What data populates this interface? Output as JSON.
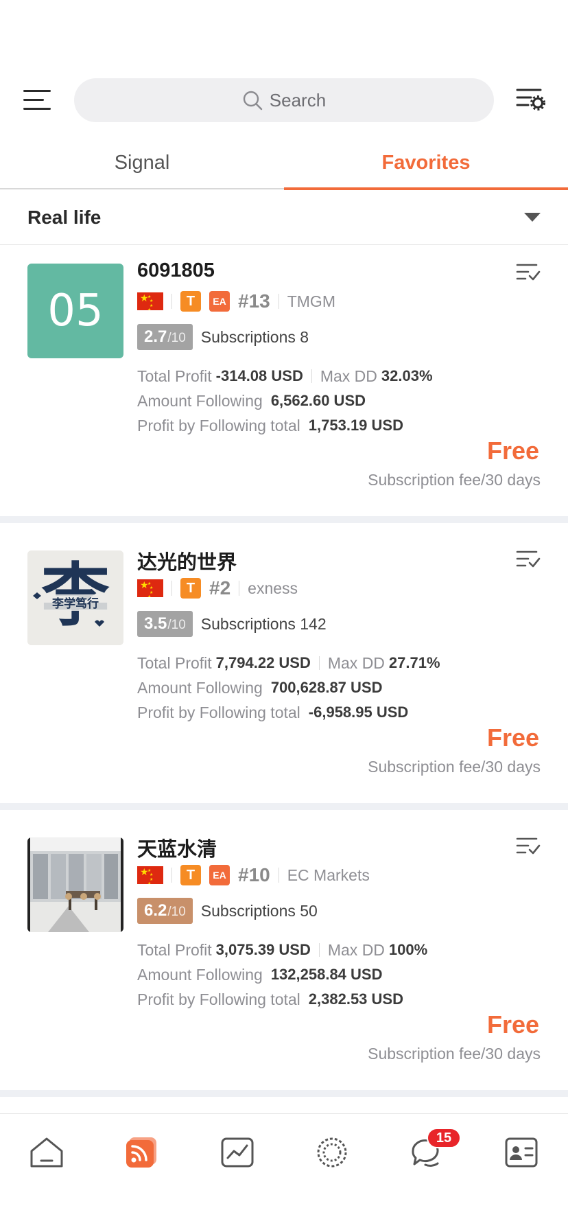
{
  "search": {
    "placeholder": "Search"
  },
  "tabs": [
    {
      "label": "Signal",
      "active": false
    },
    {
      "label": "Favorites",
      "active": true
    }
  ],
  "filter": {
    "label": "Real life"
  },
  "colors": {
    "accent": "#f26b3a",
    "score_gray": "#a3a3a3",
    "score_bronze": "#c8906a",
    "avatar_teal": "#63b9a2"
  },
  "signals": [
    {
      "avatar_text": "05",
      "name": "6091805",
      "has_ea": true,
      "type_badge": "T",
      "ea_badge": "EA",
      "rank": "#13",
      "broker": "TMGM",
      "score": "2.7",
      "score_max": "/10",
      "subscriptions_label": "Subscriptions",
      "subscriptions": "8",
      "total_profit_label": "Total Profit",
      "total_profit": "-314.08 USD",
      "max_dd_label": "Max DD",
      "max_dd": "32.03%",
      "amount_following_label": "Amount Following",
      "amount_following": "6,562.60 USD",
      "profit_following_label": "Profit by Following total",
      "profit_following": "1,753.19 USD",
      "price": "Free",
      "fee_label": "Subscription fee/30 days"
    },
    {
      "avatar_text": "李学笃行",
      "avatar_big": "李",
      "name": "达光的世界",
      "has_ea": false,
      "type_badge": "T",
      "rank": "#2",
      "broker": "exness",
      "score": "3.5",
      "score_max": "/10",
      "subscriptions_label": "Subscriptions",
      "subscriptions": "142",
      "total_profit_label": "Total Profit",
      "total_profit": "7,794.22 USD",
      "max_dd_label": "Max DD",
      "max_dd": "27.71%",
      "amount_following_label": "Amount Following",
      "amount_following": "700,628.87 USD",
      "profit_following_label": "Profit by Following total",
      "profit_following": "-6,958.95 USD",
      "price": "Free",
      "fee_label": "Subscription fee/30 days"
    },
    {
      "name": "天蓝水清",
      "has_ea": true,
      "type_badge": "T",
      "ea_badge": "EA",
      "rank": "#10",
      "broker": "EC Markets",
      "score": "6.2",
      "score_max": "/10",
      "subscriptions_label": "Subscriptions",
      "subscriptions": "50",
      "total_profit_label": "Total Profit",
      "total_profit": "3,075.39 USD",
      "max_dd_label": "Max DD",
      "max_dd": "100%",
      "amount_following_label": "Amount Following",
      "amount_following": "132,258.84 USD",
      "profit_following_label": "Profit by Following total",
      "profit_following": "2,382.53 USD",
      "price": "Free",
      "fee_label": "Subscription fee/30 days"
    }
  ],
  "bottom_nav": {
    "items": [
      "home-icon",
      "signal-feed-icon",
      "chart-icon",
      "discover-icon",
      "chat-icon",
      "profile-card-icon"
    ],
    "chat_badge": "15"
  }
}
